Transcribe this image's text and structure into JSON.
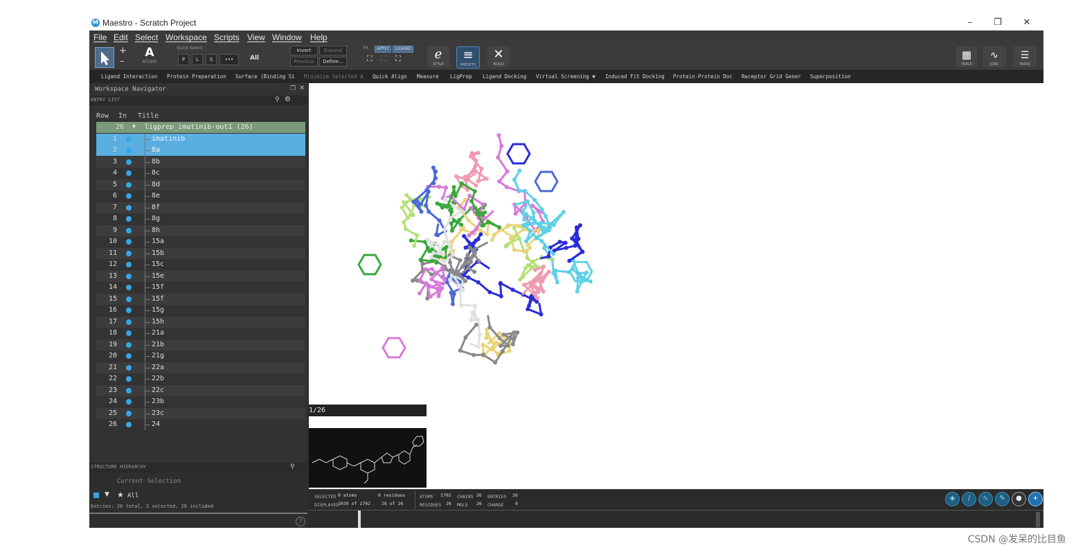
{
  "window": {
    "title": "Maestro - Scratch Project",
    "minimize": "–",
    "restore": "❐",
    "close": "✕"
  },
  "menu": [
    "File",
    "Edit",
    "Select",
    "Workspace",
    "Scripts",
    "View",
    "Window",
    "Help"
  ],
  "toolbar": {
    "atoms_label": "ATOMS",
    "quick_select_label": "Quick Select",
    "quick_select_btns": [
      "P",
      "L",
      "S",
      "•••"
    ],
    "all_label": "All",
    "invert_label": "Invert",
    "expand_label": "Expand",
    "previous_label": "Previous",
    "define_label": "Define...",
    "fit_label": "Fit",
    "apply_label": "APPLY",
    "ligand_label": "LIGAND",
    "style_label": "STYLE",
    "presets_label": "PRESETS",
    "build_label": "BUILD",
    "table_label": "TABLE",
    "jobs_label": "JOBS",
    "tasks_label": "TASKS"
  },
  "favorites": [
    "Ligand Interaction",
    "Protein Preparation",
    "Surface (Binding Si",
    "Minimize Selected A",
    "Quick Align",
    "Measure",
    "LigPrep",
    "Ligand Docking",
    "Virtual Screening ▼",
    "Induced Fit Docking",
    "Protein-Protein Doc",
    "Receptor Grid Gener",
    "Superposition"
  ],
  "navigator": {
    "title": "Workspace Navigator",
    "entry_list": "ENTRY LIST",
    "columns": {
      "row": "Row",
      "in": "In",
      "title": "Title"
    },
    "group": {
      "count": "26",
      "title": "ligprep_imatinib-out1 (26)"
    },
    "rows": [
      {
        "n": "1",
        "t": "imatinib",
        "sel": true
      },
      {
        "n": "2",
        "t": "8a",
        "sel": true
      },
      {
        "n": "3",
        "t": "8b",
        "sel": false
      },
      {
        "n": "4",
        "t": "8c",
        "sel": false
      },
      {
        "n": "5",
        "t": "8d",
        "sel": false
      },
      {
        "n": "6",
        "t": "8e",
        "sel": false
      },
      {
        "n": "7",
        "t": "8f",
        "sel": false
      },
      {
        "n": "8",
        "t": "8g",
        "sel": false
      },
      {
        "n": "9",
        "t": "8h",
        "sel": false
      },
      {
        "n": "10",
        "t": "15a",
        "sel": false
      },
      {
        "n": "11",
        "t": "15b",
        "sel": false
      },
      {
        "n": "12",
        "t": "15c",
        "sel": false
      },
      {
        "n": "13",
        "t": "15e",
        "sel": false
      },
      {
        "n": "14",
        "t": "15f",
        "sel": false
      },
      {
        "n": "15",
        "t": "15f",
        "sel": false
      },
      {
        "n": "16",
        "t": "15g",
        "sel": false
      },
      {
        "n": "17",
        "t": "15h",
        "sel": false
      },
      {
        "n": "18",
        "t": "21a",
        "sel": false
      },
      {
        "n": "19",
        "t": "21b",
        "sel": false
      },
      {
        "n": "20",
        "t": "21g",
        "sel": false
      },
      {
        "n": "21",
        "t": "22a",
        "sel": false
      },
      {
        "n": "22",
        "t": "22b",
        "sel": false
      },
      {
        "n": "23",
        "t": "22c",
        "sel": false
      },
      {
        "n": "24",
        "t": "23b",
        "sel": false
      },
      {
        "n": "25",
        "t": "23c",
        "sel": false
      },
      {
        "n": "26",
        "t": "24",
        "sel": false
      }
    ],
    "structure_hierarchy": "STRUCTURE HIERARCHY",
    "current_selection": "Current Selection",
    "all_item": "All",
    "entries_summary": "Entries: 26 total, 2 selected, 26 included"
  },
  "viewport": {
    "thumb_counter": "1/26"
  },
  "status": {
    "selected_label": "SELECTED",
    "selected_atoms": "0 atoms",
    "selected_residues": "0 residues",
    "displayed_label": "DISPLAYED",
    "displayed_atoms": "1039 of 1702",
    "displayed_entries": "26 of 26",
    "atoms_label": "ATOMS",
    "atoms_val": "1702",
    "chains_label": "CHAINS",
    "chains_val": "26",
    "entries_label": "ENTRIES",
    "entries_val": "26",
    "residues_label": "RESIDUES",
    "residues_val": "26",
    "mols_label": "MOLS",
    "mols_val": "26",
    "charge_label": "CHARGE",
    "charge_val": "0"
  },
  "watermark": "CSDN @发呆的比目鱼"
}
